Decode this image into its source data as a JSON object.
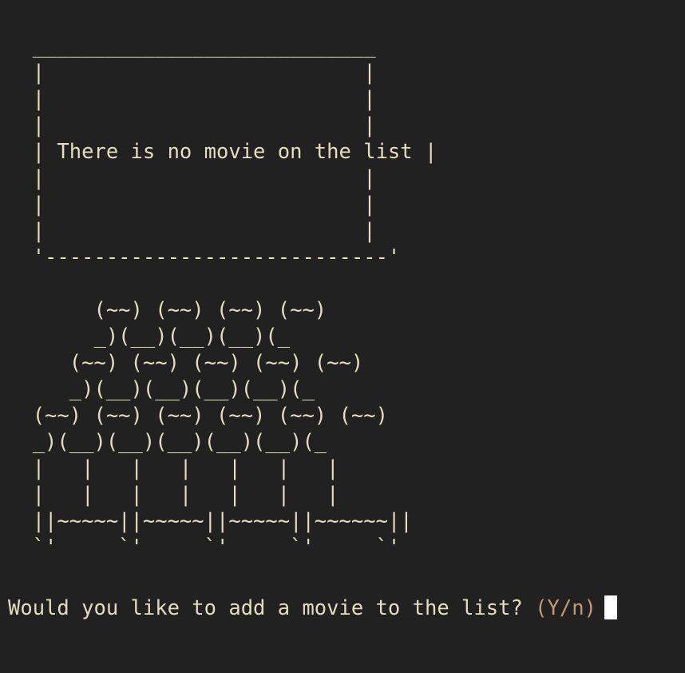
{
  "screen": {
    "lines": [
      "  ____________________________",
      "  |                          |",
      "  |                          |",
      "  |                          |",
      "  | There is no movie on the list |",
      "  |                          |",
      "  |                          |",
      "  |                          |",
      "  '----------------------------'",
      "",
      "       (~~) (~~) (~~) (~~)",
      "       _)(__)(__)(__)(_",
      "     (~~) (~~) (~~) (~~) (~~)",
      "     _)(__)(__)(__)(__)(_",
      "  (~~) (~~) (~~) (~~) (~~) (~~)",
      "  _)(__)(__)(__)(__)(__)(_",
      "  |   |   |   |   |   |   |",
      "  |   |   |   |   |   |   |",
      "  ||~~~~~||~~~~~||~~~~~||~~~~~~||",
      "  `'     `'     `'     `'     `'"
    ],
    "message": "There is no movie on the list"
  },
  "prompt": {
    "question": "Would you like to add a movie to the list?",
    "hint": "(Y/n)"
  },
  "colors": {
    "background": "#212121",
    "text": "#e5ddbd",
    "hint": "#c49a74",
    "cursor": "#ffffff"
  }
}
